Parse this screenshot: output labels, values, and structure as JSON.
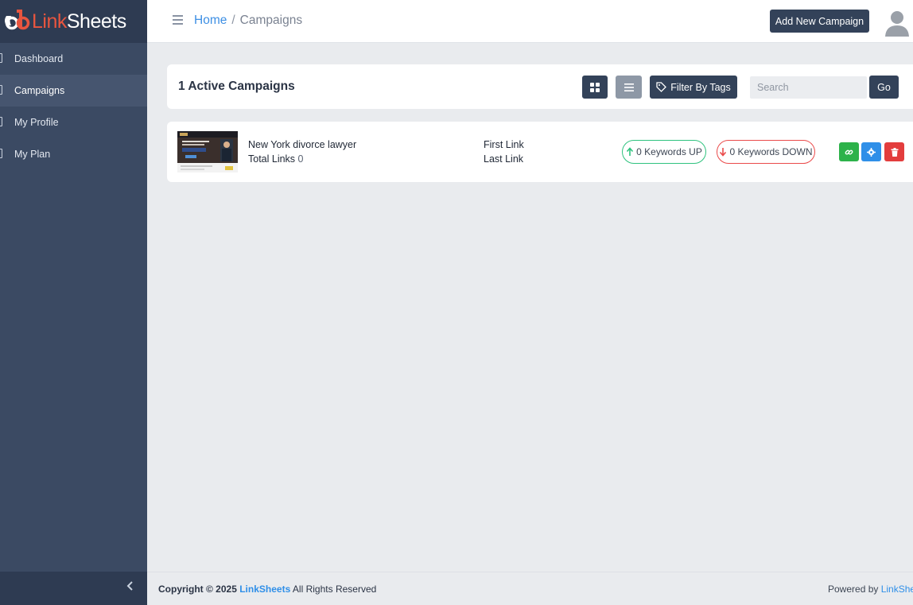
{
  "brand": {
    "name_part1": "Link",
    "name_part2": "Sheets",
    "accent_color": "#e8553f"
  },
  "sidebar": {
    "items": [
      {
        "label": "Dashboard",
        "active": false
      },
      {
        "label": "Campaigns",
        "active": true
      },
      {
        "label": "My Profile",
        "active": false
      },
      {
        "label": "My Plan",
        "active": false
      }
    ],
    "collapse_icon": "chevron-left-icon"
  },
  "header": {
    "breadcrumb_home": "Home",
    "breadcrumb_sep": "/",
    "breadcrumb_current": "Campaigns",
    "add_button_label": "Add New Campaign"
  },
  "toolbar": {
    "title": "1 Active Campaigns",
    "filter_label": "Filter By Tags",
    "search_placeholder": "Search",
    "go_label": "Go"
  },
  "campaigns": [
    {
      "name": "New York divorce lawyer",
      "total_links_label": "Total Links",
      "total_links": "0",
      "first_link_label": "First Link",
      "last_link_label": "Last Link",
      "keywords_up": "0 Keywords UP",
      "keywords_down": "0 Keywords DOWN"
    }
  ],
  "footer": {
    "copyright_prefix": "Copyright © 2025",
    "brand": "LinkSheets",
    "rights": "All Rights Reserved",
    "powered_prefix": "Powered by",
    "powered_brand": "LinkShe"
  },
  "colors": {
    "sidebar": "#3b4a63",
    "primary_button": "#334259",
    "link": "#2f8fe8",
    "up": "#2ec27e",
    "down": "#ea4a4a"
  }
}
